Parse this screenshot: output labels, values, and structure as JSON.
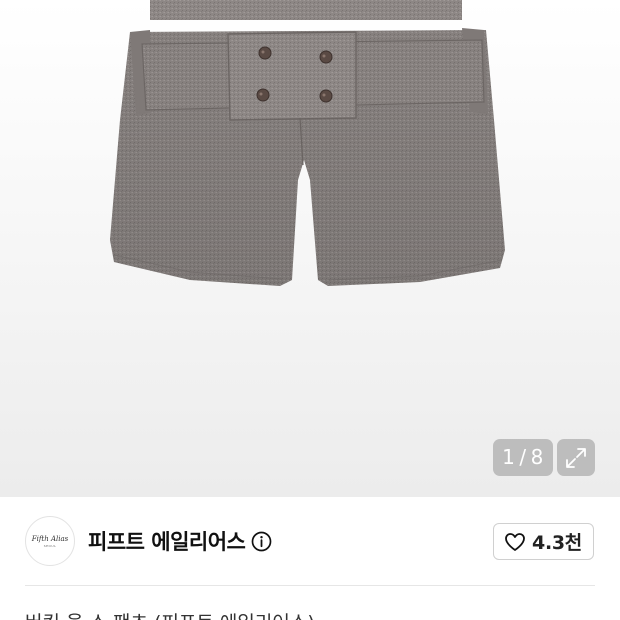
{
  "gallery": {
    "current_index": "1",
    "separator": "/",
    "total": "8",
    "expand_icon": "expand-arrows-icon"
  },
  "brand": {
    "logo_text": "Fifth Alias",
    "logo_subtext": "SEOUL",
    "name": "피프트 에일리어스",
    "info_icon": "info-circle-icon"
  },
  "like": {
    "icon": "heart-outline-icon",
    "count": "4.3천"
  },
  "product": {
    "title": "버킷 울 쇼 팬츠 (피프트 에일리어스)"
  },
  "colors": {
    "fabric": "#8e8886",
    "button": "#5a4a44",
    "overlay": "#969696"
  }
}
